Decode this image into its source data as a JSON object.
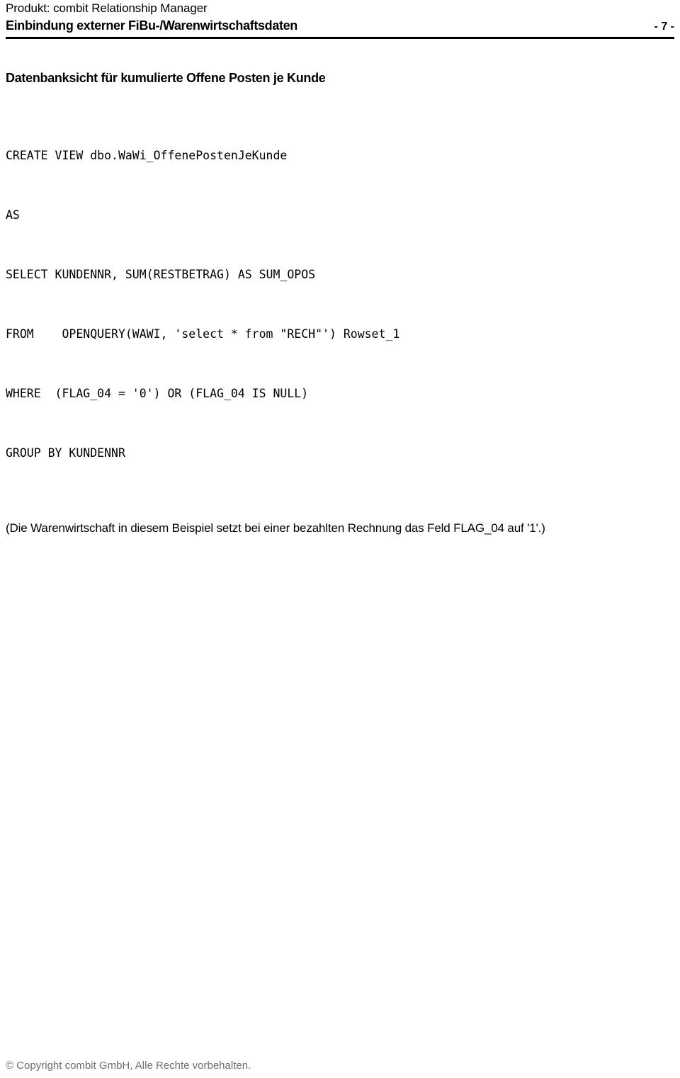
{
  "header": {
    "product_line": "Produkt: combit Relationship Manager",
    "document_title": "Einbindung externer FiBu-/Warenwirtschaftsdaten",
    "page_number": "- 7 -"
  },
  "main": {
    "section_heading": "Datenbanksicht für kumulierte Offene Posten je Kunde",
    "code": {
      "language": "sql",
      "lines": [
        "CREATE VIEW dbo.WaWi_OffenePostenJeKunde",
        "AS",
        "SELECT KUNDENNR, SUM(RESTBETRAG) AS SUM_OPOS",
        "FROM    OPENQUERY(WAWI, 'select * from \"RECH\"') Rowset_1",
        "WHERE  (FLAG_04 = '0') OR (FLAG_04 IS NULL)",
        "GROUP BY KUNDENNR"
      ],
      "line_1": "CREATE VIEW dbo.WaWi_OffenePostenJeKunde",
      "line_2": "AS",
      "line_3": "SELECT KUNDENNR, SUM(RESTBETRAG) AS SUM_OPOS",
      "line_4": "FROM    OPENQUERY(WAWI, 'select * from \"RECH\"') Rowset_1",
      "line_5": "WHERE  (FLAG_04 = '0') OR (FLAG_04 IS NULL)",
      "line_6": "GROUP BY KUNDENNR"
    },
    "note": "(Die Warenwirtschaft in diesem Beispiel setzt bei einer bezahlten Rechnung das Feld FLAG_04 auf '1'.)"
  },
  "footer": {
    "copyright": "© Copyright combit GmbH, Alle Rechte vorbehalten."
  },
  "colors": {
    "text": "#000000",
    "footer_text": "#6f6f6f",
    "rule": "#000000",
    "background": "#ffffff"
  }
}
